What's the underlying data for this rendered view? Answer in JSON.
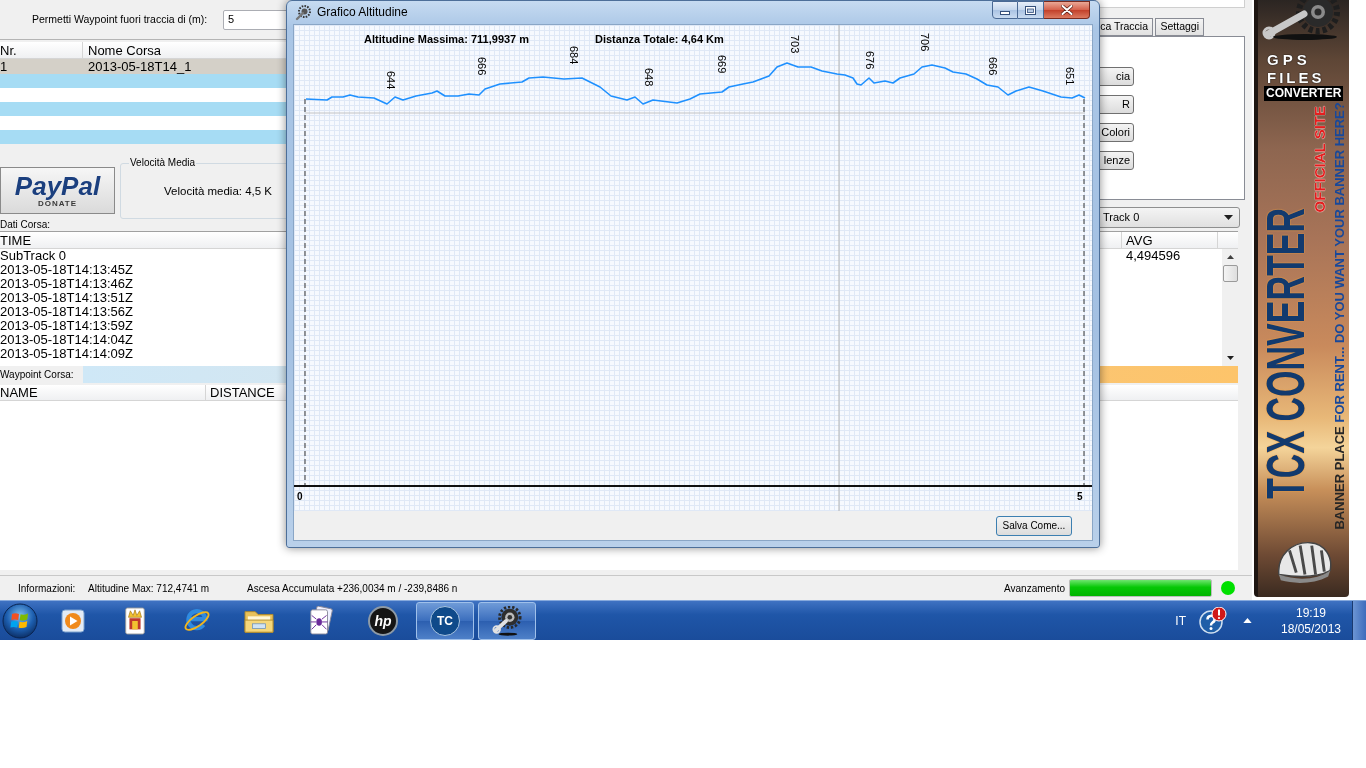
{
  "main_window": {
    "waypoint_tolerance": {
      "label": "Permetti Waypoint fuori traccia di (m):",
      "value": "5"
    },
    "races_table": {
      "columns": [
        "Nr.",
        "Nome Corsa"
      ],
      "rows": [
        {
          "number": "1",
          "name": "2013-05-18T14_1",
          "selected": true
        }
      ]
    },
    "donate_button": {
      "logo": "PayPal",
      "caption": "DONATE"
    },
    "speed_group": {
      "title": "Velocità Media",
      "text": "Velocità media: 4,5 K"
    },
    "data_label": "Dati Corsa:",
    "tabs": [
      {
        "label": "ca Traccia",
        "selected": false
      },
      {
        "label": "Settaggi",
        "selected": false
      }
    ],
    "panel_buttons": [
      "cia",
      "R",
      "Colori",
      "lenze"
    ],
    "track_select": {
      "value": "Track 0"
    },
    "data_table": {
      "columns": [
        "TIME",
        "AVG"
      ],
      "rows": [
        {
          "time": "SubTrack 0",
          "avg": "4,494596"
        },
        {
          "time": "2013-05-18T14:13:45Z"
        },
        {
          "time": "2013-05-18T14:13:46Z"
        },
        {
          "time": "2013-05-18T14:13:51Z"
        },
        {
          "time": "2013-05-18T14:13:56Z"
        },
        {
          "time": "2013-05-18T14:13:59Z"
        },
        {
          "time": "2013-05-18T14:14:04Z"
        },
        {
          "time": "2013-05-18T14:14:09Z"
        }
      ]
    },
    "waypoint_label": "Waypoint Corsa:",
    "waypoint_table": {
      "columns": [
        "NAME",
        "DISTANCE"
      ]
    },
    "status_bar": {
      "info_label": "Informazioni:",
      "max_altitude": "Altitudine Max: 712,4741 m",
      "ascent": "Ascesa Accumulata +236,0034 m / -239,8486 n",
      "progress_label": "Avanzamento",
      "progress": {
        "level": 1
      },
      "status_light": {
        "color": "#00e000"
      }
    }
  },
  "dialog": {
    "title": "Grafico Altitudine",
    "max_altitude": "Altitudine Massima: 711,9937 m",
    "total_distance": "Distanza Totale: 4,64 Km",
    "point_labels": [
      "644",
      "666",
      "684",
      "648",
      "669",
      "703",
      "676",
      "706",
      "666",
      "651"
    ],
    "x_labels": [
      "0",
      "5"
    ],
    "save_button": "Salva Come..."
  },
  "banner": {
    "gps": "GPS",
    "files": "FILES",
    "converter": "CONVERTER",
    "official": "OFFICIAL SITE",
    "title": "TCX CONVERTER",
    "tagline_start": "BANNER PLACE",
    "tagline_end": "FOR RENT... DO YOU WANT YOUR BANNER HERE?"
  },
  "taskbar": {
    "items": [
      {
        "kind": "media",
        "active": false
      },
      {
        "kind": "cards",
        "active": false
      },
      {
        "kind": "browser",
        "active": false
      },
      {
        "kind": "folder",
        "active": false
      },
      {
        "kind": "spider",
        "active": false
      },
      {
        "kind": "hp",
        "text": "hp",
        "active": false
      },
      {
        "kind": "tc",
        "text": "TC",
        "active": true
      },
      {
        "kind": "gear",
        "active": true
      }
    ],
    "language": "IT",
    "time": "19:19",
    "date": "18/05/2013"
  }
}
